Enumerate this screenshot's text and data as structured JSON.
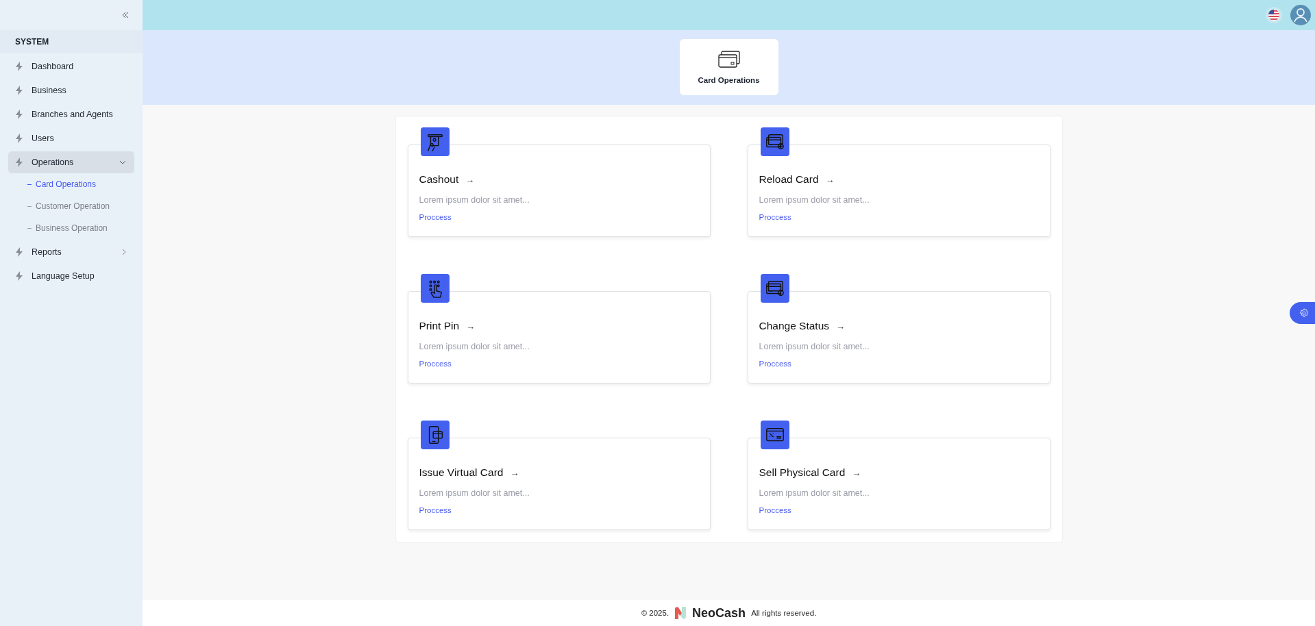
{
  "sidebar": {
    "section": "SYSTEM",
    "items": [
      {
        "label": "Dashboard",
        "kind": "link"
      },
      {
        "label": "Business",
        "kind": "link"
      },
      {
        "label": "Branches and Agents",
        "kind": "link"
      },
      {
        "label": "Users",
        "kind": "link"
      },
      {
        "label": "Operations",
        "kind": "group",
        "expanded": true,
        "children": [
          {
            "label": "Card Operations",
            "selected": true
          },
          {
            "label": "Customer Operation",
            "selected": false
          },
          {
            "label": "Business Operation",
            "selected": false
          }
        ]
      },
      {
        "label": "Reports",
        "kind": "group",
        "expanded": false
      },
      {
        "label": "Language Setup",
        "kind": "link"
      }
    ]
  },
  "page_tab": {
    "label": "Card Operations"
  },
  "cards": [
    {
      "title": "Cashout",
      "arrow": "→",
      "description": "Lorem ipsum dolor sit amet...",
      "action": "Proccess"
    },
    {
      "title": "Reload Card",
      "arrow": "→",
      "description": "Lorem ipsum dolor sit amet...",
      "action": "Proccess"
    },
    {
      "title": "Print Pin",
      "arrow": "→",
      "description": "Lorem ipsum dolor sit amet...",
      "action": "Proccess"
    },
    {
      "title": "Change Status",
      "arrow": "→",
      "description": "Lorem ipsum dolor sit amet...",
      "action": "Proccess"
    },
    {
      "title": "Issue Virtual Card",
      "arrow": "→",
      "description": "Lorem ipsum dolor sit amet...",
      "action": "Proccess"
    },
    {
      "title": "Sell Physical Card",
      "arrow": "→",
      "description": "Lorem ipsum dolor sit amet...",
      "action": "Proccess"
    }
  ],
  "footer": {
    "copyright": "© 2025.",
    "brand": "NeoCash",
    "rights": "All rights reserved."
  }
}
